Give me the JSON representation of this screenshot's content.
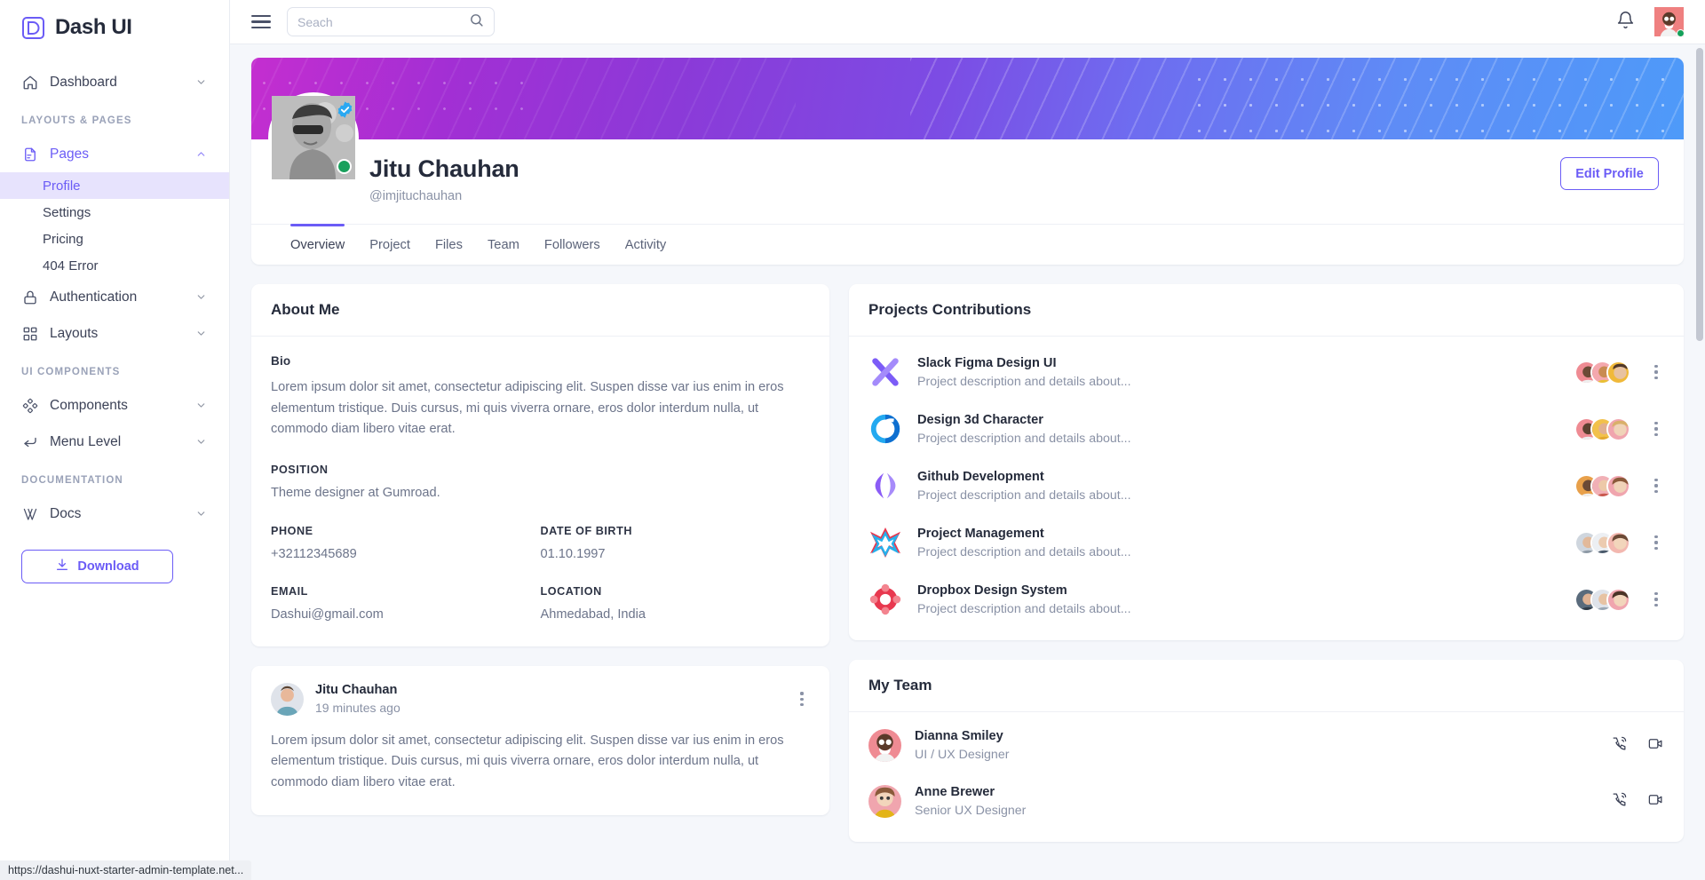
{
  "brand": {
    "name": "Dash UI",
    "logo_icon": "dash-logo-icon"
  },
  "topbar": {
    "menu_icon": "hamburger-icon",
    "search": {
      "placeholder": "Seach",
      "value": "",
      "icon": "search-icon"
    },
    "notification_icon": "bell-icon",
    "avatar_icon": "user-avatar"
  },
  "sidebar": {
    "items": [
      {
        "label": "Dashboard",
        "icon": "home-icon",
        "chevron": "chevron-down-icon"
      }
    ],
    "sections": [
      {
        "title": "LAYOUTS & PAGES",
        "items": [
          {
            "label": "Pages",
            "icon": "pages-icon",
            "chevron": "chevron-up-icon",
            "active": true,
            "children": [
              {
                "label": "Profile",
                "selected": true
              },
              {
                "label": "Settings",
                "selected": false
              },
              {
                "label": "Pricing",
                "selected": false
              },
              {
                "label": "404 Error",
                "selected": false
              }
            ]
          },
          {
            "label": "Authentication",
            "icon": "lock-icon",
            "chevron": "chevron-down-icon"
          },
          {
            "label": "Layouts",
            "icon": "grid-icon",
            "chevron": "chevron-down-icon"
          }
        ]
      },
      {
        "title": "UI COMPONENTS",
        "items": [
          {
            "label": "Components",
            "icon": "components-icon",
            "chevron": "chevron-down-icon"
          },
          {
            "label": "Menu Level",
            "icon": "menu-level-icon",
            "chevron": "chevron-down-icon"
          }
        ]
      },
      {
        "title": "DOCUMENTATION",
        "items": [
          {
            "label": "Docs",
            "icon": "docs-icon",
            "chevron": "chevron-down-icon"
          }
        ]
      }
    ],
    "download_button": {
      "label": "Download",
      "icon": "download-icon"
    }
  },
  "profile": {
    "name": "Jitu Chauhan",
    "handle": "@imjituchauhan",
    "verified_icon": "verified-badge-icon",
    "status": "online",
    "edit_button": "Edit Profile",
    "tabs": [
      {
        "label": "Overview",
        "active": true
      },
      {
        "label": "Project",
        "active": false
      },
      {
        "label": "Files",
        "active": false
      },
      {
        "label": "Team",
        "active": false
      },
      {
        "label": "Followers",
        "active": false
      },
      {
        "label": "Activity",
        "active": false
      }
    ]
  },
  "about": {
    "title": "About Me",
    "bio_label": "Bio",
    "bio_text": "Lorem ipsum dolor sit amet, consectetur adipiscing elit. Suspen disse var ius enim in eros elementum tristique. Duis cursus, mi quis viverra ornare, eros dolor interdum nulla, ut commodo diam libero vitae erat.",
    "fields": [
      {
        "label": "POSITION",
        "value": "Theme designer at Gumroad."
      },
      {
        "label": "PHONE",
        "value": "+32112345689"
      },
      {
        "label": "DATE OF BIRTH",
        "value": "01.10.1997"
      },
      {
        "label": "EMAIL",
        "value": "Dashui@gmail.com"
      },
      {
        "label": "LOCATION",
        "value": "Ahmedabad, India"
      }
    ]
  },
  "projects": {
    "title": "Projects Contributions",
    "items": [
      {
        "name": "Slack Figma Design UI",
        "desc": "Project description and details about...",
        "icon": "slack-figma-icon"
      },
      {
        "name": "Design 3d Character",
        "desc": "Project description and details about...",
        "icon": "design-3d-icon"
      },
      {
        "name": "Github Development",
        "desc": "Project description and details about...",
        "icon": "github-dev-icon"
      },
      {
        "name": "Project Management",
        "desc": "Project description and details about...",
        "icon": "project-management-icon"
      },
      {
        "name": "Dropbox Design System",
        "desc": "Project description and details about...",
        "icon": "dropbox-design-icon"
      }
    ],
    "menu_icon": "kebab-menu-icon"
  },
  "post": {
    "author": "Jitu Chauhan",
    "time": "19 minutes ago",
    "text": "Lorem ipsum dolor sit amet, consectetur adipiscing elit. Suspen disse var ius enim in eros elementum tristique. Duis cursus, mi quis viverra ornare, eros dolor interdum nulla, ut commodo diam libero vitae erat.",
    "menu_icon": "kebab-menu-icon"
  },
  "team": {
    "title": "My Team",
    "members": [
      {
        "name": "Dianna Smiley",
        "role": "UI / UX Designer",
        "phone_icon": "phone-call-icon",
        "video_icon": "video-call-icon"
      },
      {
        "name": "Anne Brewer",
        "role": "Senior UX Designer",
        "phone_icon": "phone-call-icon",
        "video_icon": "video-call-icon"
      }
    ]
  },
  "statusbar": {
    "url": "https://dashui-nuxt-starter-admin-template.net..."
  },
  "colors": {
    "accent": "#6b5cf6",
    "accent_soft": "#e7e3fd",
    "text_dark": "#252b3b",
    "text_muted": "#8a92a6",
    "online": "#18a05c",
    "page_bg": "#f5f7fb"
  }
}
